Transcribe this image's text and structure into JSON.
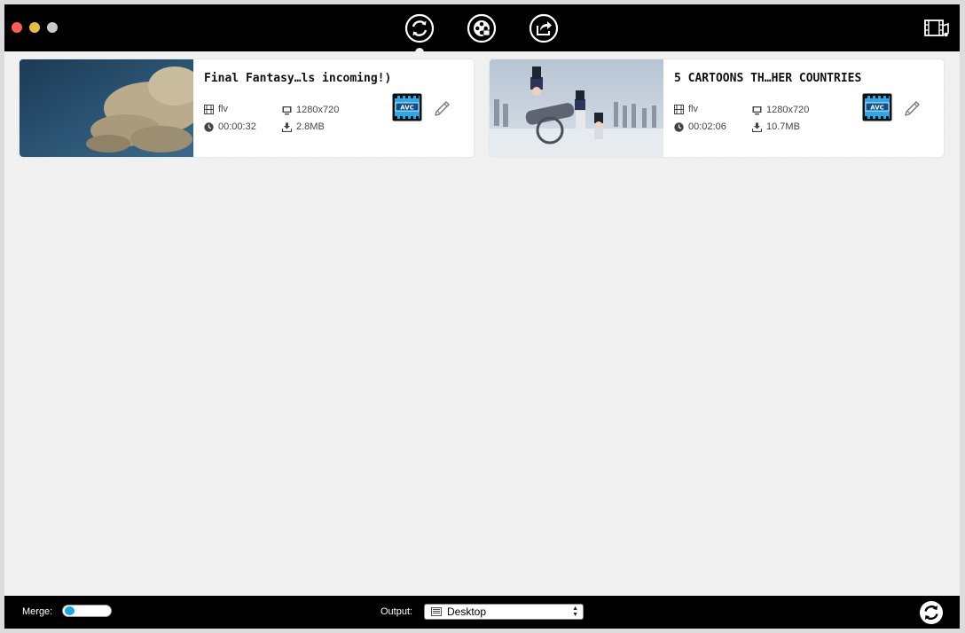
{
  "window": {
    "toolbar": {
      "tools": [
        "convert-icon",
        "film-reel-icon",
        "share-icon"
      ],
      "library": "film-library-icon"
    }
  },
  "videos": [
    {
      "title": "Final Fantasy…ls incoming!)",
      "format": "flv",
      "resolution": "1280x720",
      "duration": "00:00:32",
      "size": "2.8MB",
      "codec": "AVC"
    },
    {
      "title": "5 CARTOONS TH…HER COUNTRIES",
      "format": "flv",
      "resolution": "1280x720",
      "duration": "00:02:06",
      "size": "10.7MB",
      "codec": "AVC"
    }
  ],
  "bottom": {
    "merge_label": "Merge:",
    "merge_on": false,
    "output_label": "Output:",
    "output_value": "Desktop"
  },
  "colors": {
    "toolbar_bg": "#000000",
    "accent": "#1ea5e9",
    "card_bg": "#ffffff"
  }
}
